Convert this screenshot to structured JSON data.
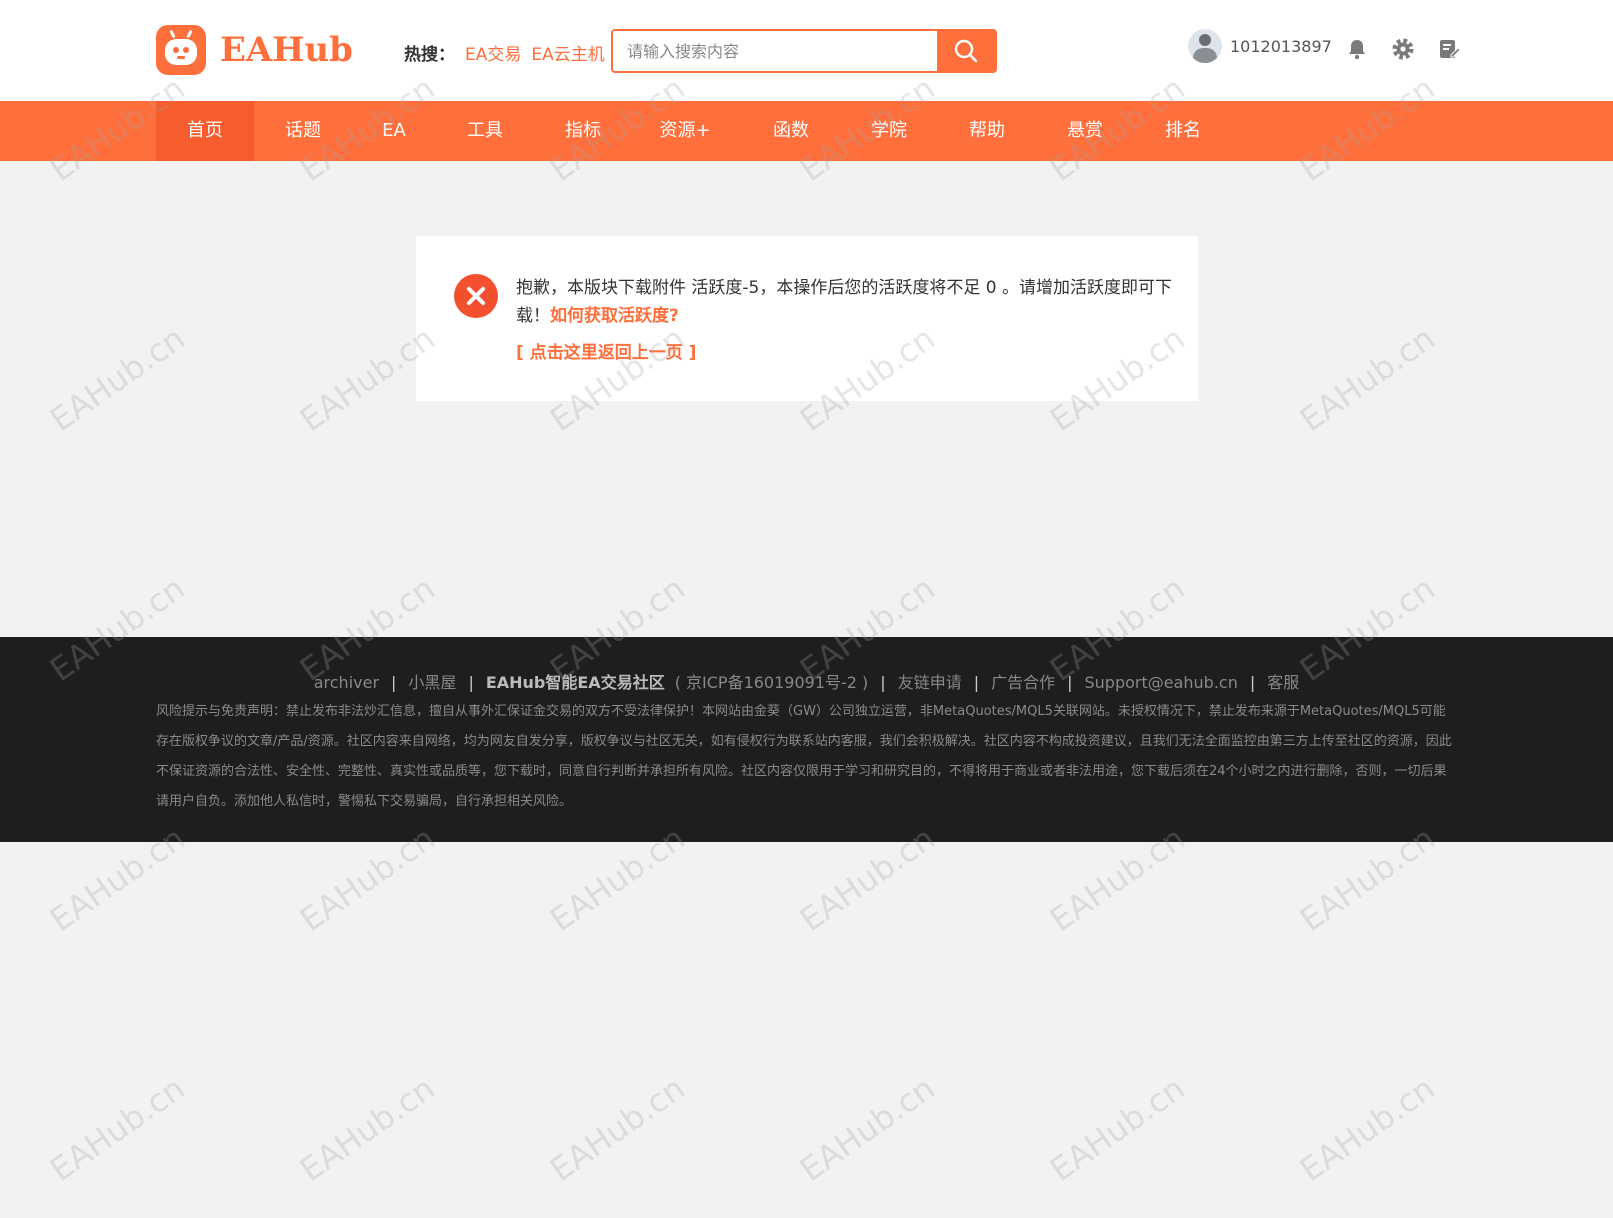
{
  "brand": {
    "name": "EAHub"
  },
  "hot": {
    "label": "热搜：",
    "links": [
      "EA交易",
      "EA云主机"
    ]
  },
  "search": {
    "placeholder": "请输入搜索内容"
  },
  "user": {
    "name": "1012013897"
  },
  "nav": {
    "items": [
      "首页",
      "话题",
      "EA",
      "工具",
      "指标",
      "资源+",
      "函数",
      "学院",
      "帮助",
      "悬赏",
      "排名"
    ],
    "active": "首页"
  },
  "message": {
    "text": "抱歉，本版块下载附件 活跃度-5，本操作后您的活跃度将不足 0 。请增加活跃度即可下载！",
    "link": "如何获取活跃度?",
    "back": "[ 点击这里返回上一页 ]"
  },
  "footer": {
    "links": [
      "archiver",
      "小黑屋",
      "EAHub智能EA交易社区",
      "( 京ICP备16019091号-2 )",
      "友链申请",
      "广告合作",
      "Support@eahub.cn",
      "客服"
    ],
    "disclaimer": "风险提示与免责声明：禁止发布非法炒汇信息，擅自从事外汇保证金交易的双方不受法律保护！本网站由金葵（GW）公司独立运营，非MetaQuotes/MQL5关联网站。未授权情况下，禁止发布来源于MetaQuotes/MQL5可能存在版权争议的文章/产品/资源。社区内容来自网络，均为网友自发分享，版权争议与社区无关，如有侵权行为联系站内客服，我们会积极解决。社区内容不构成投资建议，且我们无法全面监控由第三方上传至社区的资源，因此不保证资源的合法性、安全性、完整性、真实性或品质等，您下载时，同意自行判断并承担所有风险。社区内容仅限用于学习和研究目的，不得将用于商业或者非法用途，您下载后须在24个小时之内进行删除，否则，一切后果请用户自负。添加他人私信时，警惕私下交易骗局，自行承担相关风险。"
  },
  "watermark": "EAHub.cn",
  "colors": {
    "accent": "#ff6f3c",
    "nav_active": "#f65c2d",
    "error": "#f2502f",
    "footer_bg": "#1e1e1e"
  }
}
